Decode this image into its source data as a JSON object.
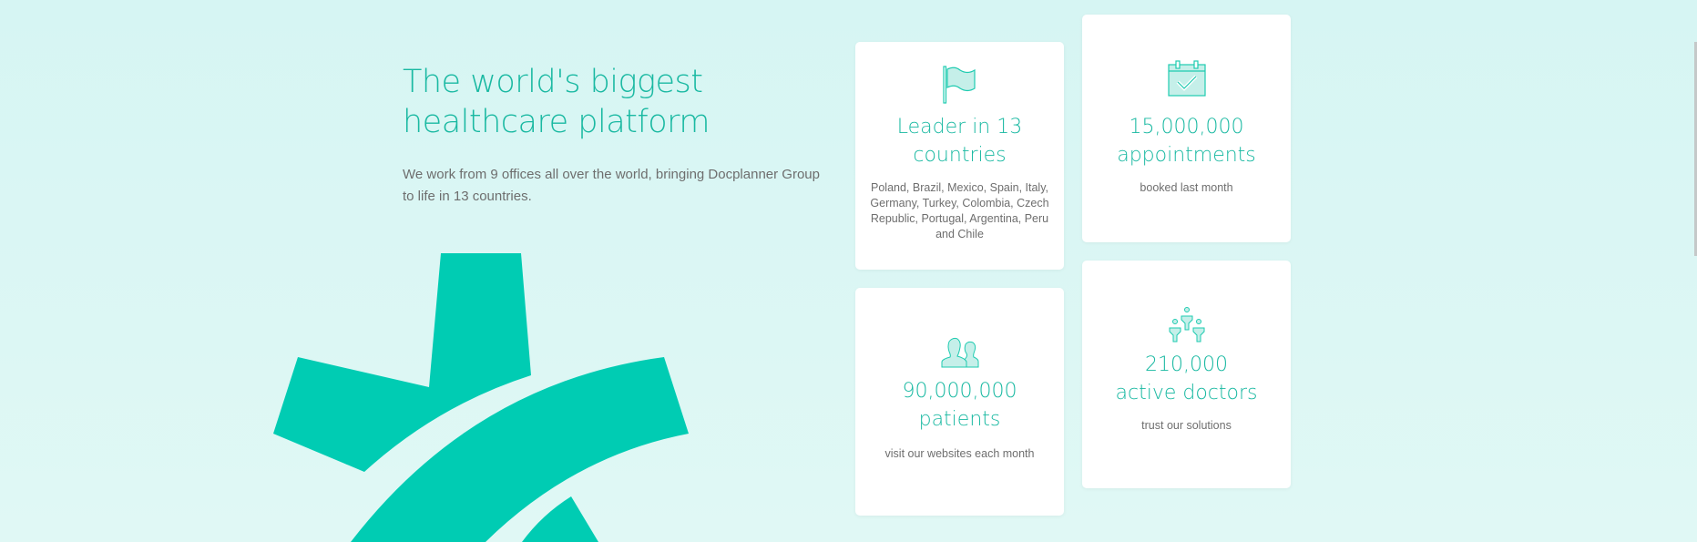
{
  "intro": {
    "title_line1": "The world's biggest",
    "title_line2": "healthcare platform",
    "description": "We work from 9 offices all over the world, bringing Docplanner Group to life in 13 countries."
  },
  "colors": {
    "brand": "#00ccb3",
    "accent_text": "#1ab9a2",
    "body_text": "#6e6e6e"
  },
  "cards": [
    {
      "icon": "flag-icon",
      "title_line1": "Leader in 13",
      "title_line2": "countries",
      "description": "Poland, Brazil, Mexico, Spain, Italy, Germany, Turkey, Colombia, Czech Republic, Portugal, Argentina, Peru and Chile"
    },
    {
      "icon": "calendar-check-icon",
      "title_line1": "15,000,000",
      "title_line2": "appointments",
      "description": "booked last month"
    },
    {
      "icon": "users-icon",
      "title_line1": "90,000,000",
      "title_line2": "patients",
      "description": "visit our websites each month"
    },
    {
      "icon": "doctors-icon",
      "title_line1": "210,000",
      "title_line2": "active doctors",
      "description": "trust our solutions"
    }
  ]
}
